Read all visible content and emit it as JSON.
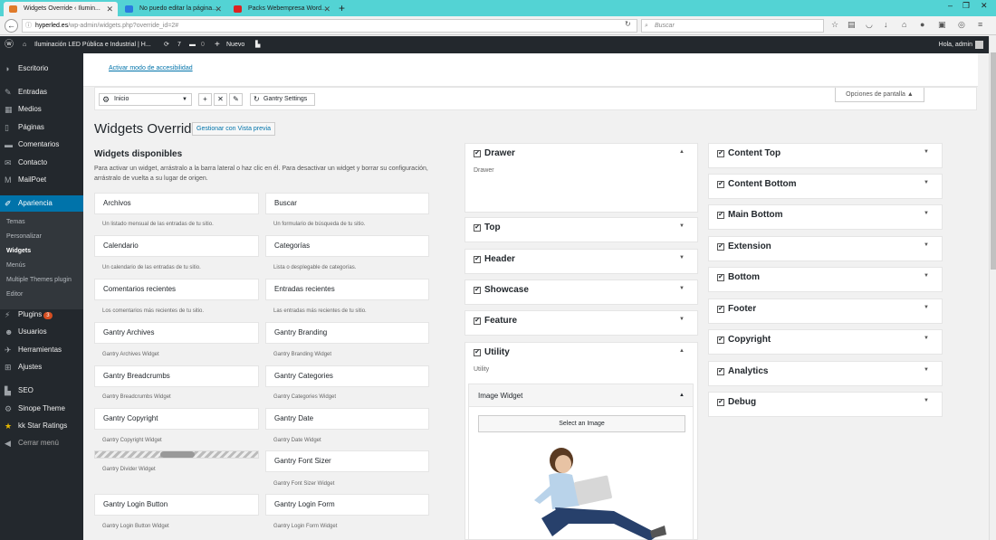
{
  "browser": {
    "tabs": [
      {
        "label": "Widgets Override ‹ Ilumin...",
        "active": true,
        "favicon_color": "#e07b2a"
      },
      {
        "label": "No puedo editar la página...",
        "active": false,
        "favicon_color": "#2a7be0"
      },
      {
        "label": "Packs Webempresa Word...",
        "active": false,
        "favicon_color": "#d22"
      }
    ],
    "url_host": "hyperled.es",
    "url_path": "/wp-admin/widgets.php?override_id=2#",
    "search_placeholder": "Buscar"
  },
  "adminbar": {
    "site_name": "Iluminación LED Pública e Industrial | H...",
    "updates": "7",
    "comments": "0",
    "new_label": "Nuevo",
    "greeting": "Hola, admin"
  },
  "sidebar": {
    "items": [
      {
        "label": "Escritorio",
        "icon": "dashboard-icon"
      },
      {
        "label": "Entradas",
        "icon": "pin-icon"
      },
      {
        "label": "Medios",
        "icon": "media-icon"
      },
      {
        "label": "Páginas",
        "icon": "page-icon"
      },
      {
        "label": "Comentarios",
        "icon": "comment-icon"
      },
      {
        "label": "Contacto",
        "icon": "mail-icon"
      },
      {
        "label": "MailPoet",
        "icon": "mailpoet-icon"
      },
      {
        "label": "Apariencia",
        "icon": "brush-icon"
      },
      {
        "label": "Plugins",
        "icon": "plugin-icon",
        "badge": "3"
      },
      {
        "label": "Usuarios",
        "icon": "user-icon"
      },
      {
        "label": "Herramientas",
        "icon": "wrench-icon"
      },
      {
        "label": "Ajustes",
        "icon": "settings-icon"
      },
      {
        "label": "SEO",
        "icon": "seo-icon"
      },
      {
        "label": "Sinope Theme",
        "icon": "gear-icon"
      },
      {
        "label": "kk Star Ratings",
        "icon": "star-icon"
      },
      {
        "label": "Cerrar menú",
        "icon": "collapse-icon"
      }
    ],
    "appearance_sub": [
      "Temas",
      "Personalizar",
      "Widgets",
      "Menús",
      "Multiple Themes plugin",
      "Editor"
    ]
  },
  "notice": {
    "a11y_link": "Activar modo de accesibilidad"
  },
  "gantry": {
    "outline_select": "Inicio",
    "settings_label": "Gantry Settings"
  },
  "screen_options": "Opciones de pantalla ▲",
  "page": {
    "title": "Widgets Override",
    "manage_button": "Gestionar con Vista previa"
  },
  "available": {
    "title": "Widgets disponibles",
    "description": "Para activar un widget, arrástralo a la barra lateral o haz clic en él. Para desactivar un widget y borrar su configuración, arrástralo de vuelta a su lugar de origen.",
    "widgets": [
      {
        "name": "Archivos",
        "desc": "Un listado mensual de las entradas de tu sitio."
      },
      {
        "name": "Buscar",
        "desc": "Un formulario de búsqueda de tu sitio."
      },
      {
        "name": "Calendario",
        "desc": "Un calendario de las entradas de tu sitio."
      },
      {
        "name": "Categorías",
        "desc": "Lista o desplegable de categorías."
      },
      {
        "name": "Comentarios recientes",
        "desc": "Los comentarios más recientes de tu sitio."
      },
      {
        "name": "Entradas recientes",
        "desc": "Las entradas más recientes de tu sitio."
      },
      {
        "name": "Gantry Archives",
        "desc": "Gantry Archives Widget"
      },
      {
        "name": "Gantry Branding",
        "desc": "Gantry Branding Widget"
      },
      {
        "name": "Gantry Breadcrumbs",
        "desc": "Gantry Breadcrumbs Widget"
      },
      {
        "name": "Gantry Categories",
        "desc": "Gantry Categories Widget"
      },
      {
        "name": "Gantry Copyright",
        "desc": "Gantry Copyright Widget"
      },
      {
        "name": "Gantry Date",
        "desc": "Gantry Date Widget"
      },
      {
        "name": "",
        "desc": "Gantry Divider Widget"
      },
      {
        "name": "Gantry Font Sizer",
        "desc": "Gantry Font Sizer Widget"
      },
      {
        "name": "Gantry Login Button",
        "desc": "Gantry Login Button Widget"
      },
      {
        "name": "Gantry Login Form",
        "desc": "Gantry Login Form Widget"
      }
    ]
  },
  "areas_left": [
    {
      "name": "Drawer",
      "sub": "Drawer",
      "arrow": "▲"
    },
    {
      "name": "Top",
      "arrow": "▼"
    },
    {
      "name": "Header",
      "arrow": "▼"
    },
    {
      "name": "Showcase",
      "arrow": "▼"
    },
    {
      "name": "Feature",
      "arrow": "▼"
    },
    {
      "name": "Utility",
      "sub": "Utility",
      "arrow": "▲"
    }
  ],
  "areas_right": [
    {
      "name": "Content Top",
      "arrow": "▼"
    },
    {
      "name": "Content Bottom",
      "arrow": "▼"
    },
    {
      "name": "Main Bottom",
      "arrow": "▼"
    },
    {
      "name": "Extension",
      "arrow": "▼"
    },
    {
      "name": "Bottom",
      "arrow": "▼"
    },
    {
      "name": "Footer",
      "arrow": "▼"
    },
    {
      "name": "Copyright",
      "arrow": "▼"
    },
    {
      "name": "Analytics",
      "arrow": "▼"
    },
    {
      "name": "Debug",
      "arrow": "▼"
    }
  ],
  "image_widget": {
    "title": "Image Widget",
    "button": "Select an Image"
  }
}
